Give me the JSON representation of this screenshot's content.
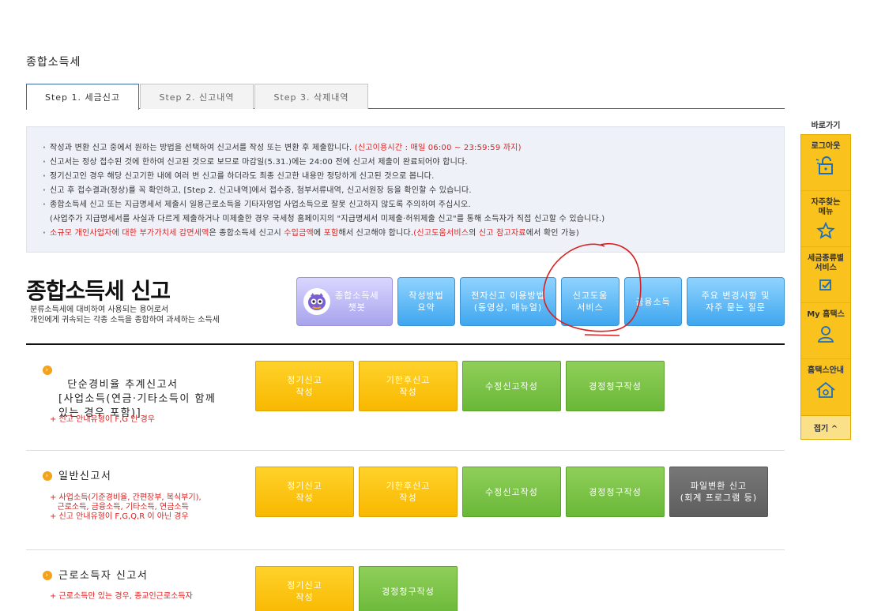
{
  "page_title": "종합소득세",
  "tabs": [
    {
      "label": "Step 1. 세금신고",
      "active": true
    },
    {
      "label": "Step 2. 신고내역",
      "active": false
    },
    {
      "label": "Step 3. 삭제내역",
      "active": false
    }
  ],
  "info": {
    "line1": "작성과 변환 신고 중에서 원하는 방법을 선택하여 신고서를 작성 또는 변환 후 제출합니다.",
    "line1_hours": "(신고이용시간 : 매일 06:00 ~ 23:59:59 까지)",
    "line2": "신고서는 정상 접수된 것에 한하여 신고된 것으로 보므로 마감일(5.31.)에는 24:00 전에 신고서 제출이 완료되어야 합니다.",
    "line3": "정기신고인 경우 해당 신고기한 내에 여러 번 신고를 하더라도 최종 신고한 내용만 정당하게 신고된 것으로 봅니다.",
    "line4": "신고 후 접수결과(정상)를 꼭 확인하고, [Step 2. 신고내역]에서 접수증, 첨부서류내역, 신고서원장 등을 확인할 수 있습니다.",
    "line5": "종합소득세 신고 또는 지급명세서 제출시 일용근로소득을 기타자영업 사업소득으로 잘못 신고하지 않도록 주의하여 주십시오.",
    "line5b": "(사업주가 지급명세서를 사실과 다르게 제출하거나 미제출한 경우 국세청 홈페이지의 \"지급명세서 미제출·허위제출 신고\"를 통해 소득자가 직접 신고할 수 있습니다.)",
    "line6_a": "소규모 개인사업자에 대한 부가가치세 감면세액",
    "line6_b": "은 종합소득세 신고시 ",
    "line6_c": "수입금액",
    "line6_d": "에 ",
    "line6_e": "포함",
    "line6_f": "해서 신고해야 합니다.",
    "line6_g": "(신고도움서비스",
    "line6_h": "의 ",
    "line6_i": "신고 참고자료",
    "line6_j": "에서 확인 가능)"
  },
  "heading": {
    "title": "종합소득세 신고",
    "desc1": "분류소득세에 대비하여 사용되는 용어로서",
    "desc2": "개인에게 귀속되는 각종 소득을 종합하여 과세하는 소득세"
  },
  "quick_buttons": {
    "chatbot": "종합소득세\n챗봇",
    "guide": "작성방법\n요약",
    "e_filing": "전자신고 이용방법\n(동영상, 매뉴얼)",
    "help_service": "신고도움\n서비스",
    "financial": "금융소득",
    "faq": "주요 변경사항 및\n자주 묻는 질문"
  },
  "sections": [
    {
      "title": "단순경비율 추계신고서\n[사업소득(연금·기타소득이 함께\n있는 경우 포함)]",
      "notes": "+ 신고 안내유형이 F,G 인 경우",
      "buttons": [
        "정기신고\n작성",
        "기한후신고\n작성",
        "수정신고작성",
        "경정청구작성"
      ]
    },
    {
      "title": "일반신고서",
      "notes": "+ 사업소득(기준경비율, 간편장부, 복식부기),\n   근로소득, 금융소득, 기타소득, 연금소득\n+ 신고 안내유형이 F,G,Q,R 이 아닌 경우",
      "buttons": [
        "정기신고\n작성",
        "기한후신고\n작성",
        "수정신고작성",
        "경정청구작성",
        "파일변환 신고\n(회계 프로그램 등)"
      ]
    },
    {
      "title": "근로소득자 신고서",
      "notes": "+ 근로소득만 있는 경우, 종교인근로소득자",
      "buttons": [
        "정기신고\n작성",
        "경정청구작성"
      ]
    }
  ],
  "quick_menu": {
    "title": "바로가기",
    "items": [
      "로그아웃",
      "자주찾는\n메뉴",
      "세금종류별\n서비스",
      "My 홈택스",
      "홈택스안내"
    ],
    "fold": "접기 ^"
  },
  "colors": {
    "yellow_button": "#f8b800",
    "green_button": "#6ab838",
    "gray_button": "#5e5e5e",
    "blue_button": "#3fa6ee",
    "quick_panel": "#f9c21d",
    "alert_red": "#e02020",
    "tab_border": "#3a68a8"
  }
}
